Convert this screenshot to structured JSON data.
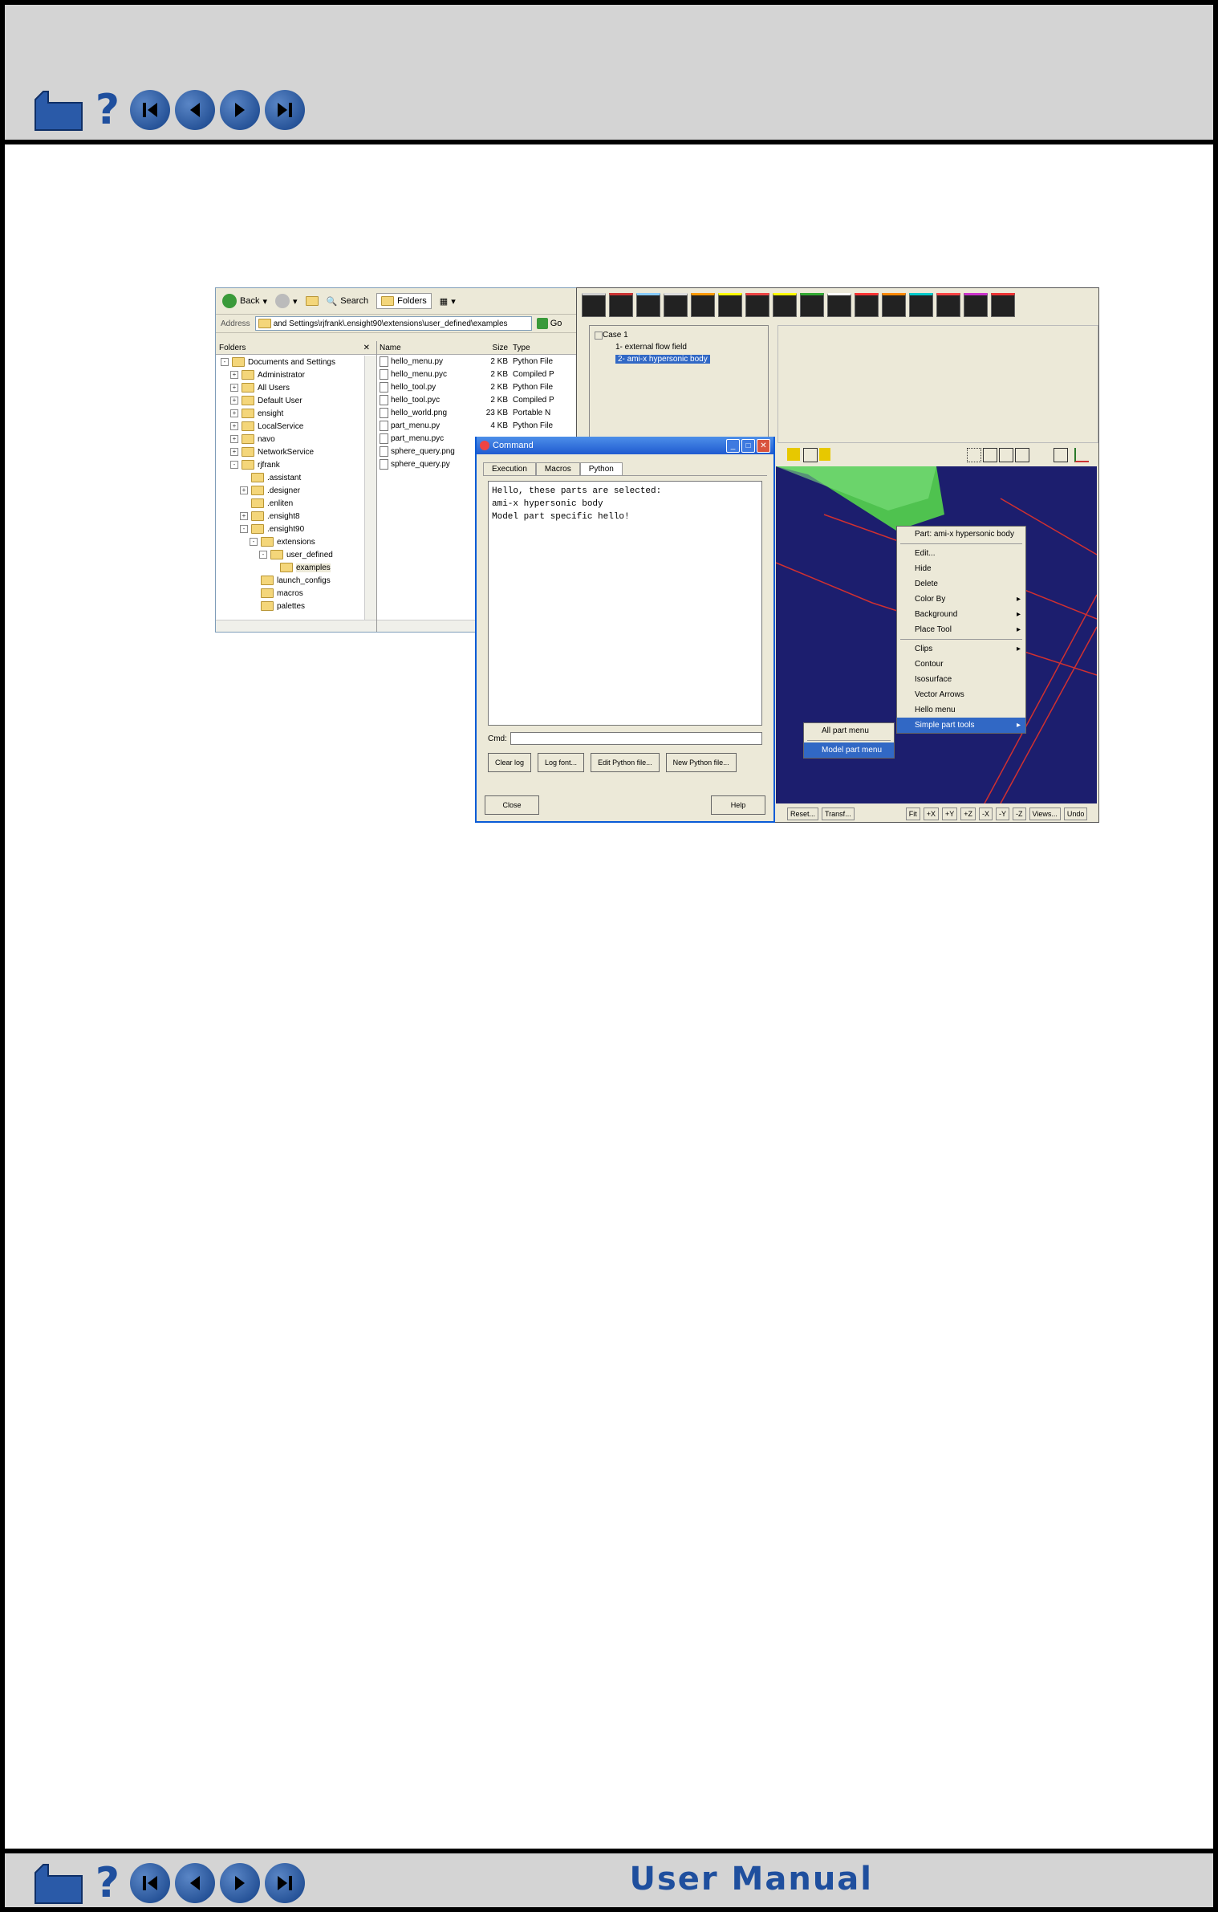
{
  "footer": {
    "title": "User Manual"
  },
  "explorer": {
    "back_label": "Back",
    "search_label": "Search",
    "folders_button_label": "Folders",
    "address_label": "Address",
    "address_value": "and Settings\\rjfrank\\.ensight90\\extensions\\user_defined\\examples",
    "go_label": "Go",
    "folders_pane_title": "Folders",
    "close_glyph": "✕",
    "tree": [
      {
        "label": "Documents and Settings",
        "toggle": "-"
      },
      {
        "label": "Administrator",
        "toggle": "+"
      },
      {
        "label": "All Users",
        "toggle": "+"
      },
      {
        "label": "Default User",
        "toggle": "+"
      },
      {
        "label": "ensight",
        "toggle": "+"
      },
      {
        "label": "LocalService",
        "toggle": "+"
      },
      {
        "label": "navo",
        "toggle": "+"
      },
      {
        "label": "NetworkService",
        "toggle": "+"
      },
      {
        "label": "rjfrank",
        "toggle": "-"
      },
      {
        "label": ".assistant",
        "toggle": ""
      },
      {
        "label": ".designer",
        "toggle": "+"
      },
      {
        "label": ".enliten",
        "toggle": ""
      },
      {
        "label": ".ensight8",
        "toggle": "+"
      },
      {
        "label": ".ensight90",
        "toggle": "-"
      },
      {
        "label": "extensions",
        "toggle": "-"
      },
      {
        "label": "user_defined",
        "toggle": "-"
      },
      {
        "label": "examples",
        "toggle": ""
      },
      {
        "label": "launch_configs",
        "toggle": ""
      },
      {
        "label": "macros",
        "toggle": ""
      },
      {
        "label": "palettes",
        "toggle": ""
      }
    ],
    "columns": {
      "name": "Name",
      "size": "Size",
      "type": "Type"
    },
    "files": [
      {
        "name": "hello_menu.py",
        "size": "2 KB",
        "type": "Python File"
      },
      {
        "name": "hello_menu.pyc",
        "size": "2 KB",
        "type": "Compiled P"
      },
      {
        "name": "hello_tool.py",
        "size": "2 KB",
        "type": "Python File"
      },
      {
        "name": "hello_tool.pyc",
        "size": "2 KB",
        "type": "Compiled P"
      },
      {
        "name": "hello_world.png",
        "size": "23 KB",
        "type": "Portable N"
      },
      {
        "name": "part_menu.py",
        "size": "4 KB",
        "type": "Python File"
      },
      {
        "name": "part_menu.pyc",
        "size": "",
        "type": ""
      },
      {
        "name": "sphere_query.png",
        "size": "",
        "type": ""
      },
      {
        "name": "sphere_query.py",
        "size": "",
        "type": ""
      }
    ]
  },
  "ensight": {
    "parts": [
      {
        "label": "Case 1"
      },
      {
        "label": "1- external flow field"
      },
      {
        "label": "2- ami-x hypersonic body"
      }
    ],
    "bottom_buttons": [
      "Reset...",
      "Transf...",
      "Fit",
      "+X",
      "+Y",
      "+Z",
      "-X",
      "-Y",
      "-Z",
      "Views...",
      "Undo"
    ],
    "context_menu": [
      {
        "label": "Part: ami-x hypersonic body",
        "arrow": ""
      },
      {
        "label": "Edit...",
        "arrow": ""
      },
      {
        "label": "Hide",
        "arrow": ""
      },
      {
        "label": "Delete",
        "arrow": ""
      },
      {
        "label": "Color By",
        "arrow": "▸"
      },
      {
        "label": "Background",
        "arrow": "▸"
      },
      {
        "label": "Place Tool",
        "arrow": "▸"
      },
      {
        "label": "Clips",
        "arrow": "▸"
      },
      {
        "label": "Contour",
        "arrow": ""
      },
      {
        "label": "Isosurface",
        "arrow": ""
      },
      {
        "label": "Vector Arrows",
        "arrow": ""
      },
      {
        "label": "Hello menu",
        "arrow": ""
      },
      {
        "label": "Simple part tools",
        "arrow": "▸"
      }
    ],
    "submenu": [
      {
        "label": "All part menu"
      },
      {
        "label": "Model part menu"
      }
    ]
  },
  "command": {
    "title": "Command",
    "tabs": [
      "Execution",
      "Macros",
      "Python"
    ],
    "output": [
      "Hello, these parts are selected:",
      "ami-x hypersonic body",
      "Model part specific hello!"
    ],
    "cmd_label": "Cmd:",
    "buttons": [
      "Clear log",
      "Log font...",
      "Edit Python file...",
      "New Python file..."
    ],
    "close_label": "Close",
    "help_label": "Help"
  }
}
